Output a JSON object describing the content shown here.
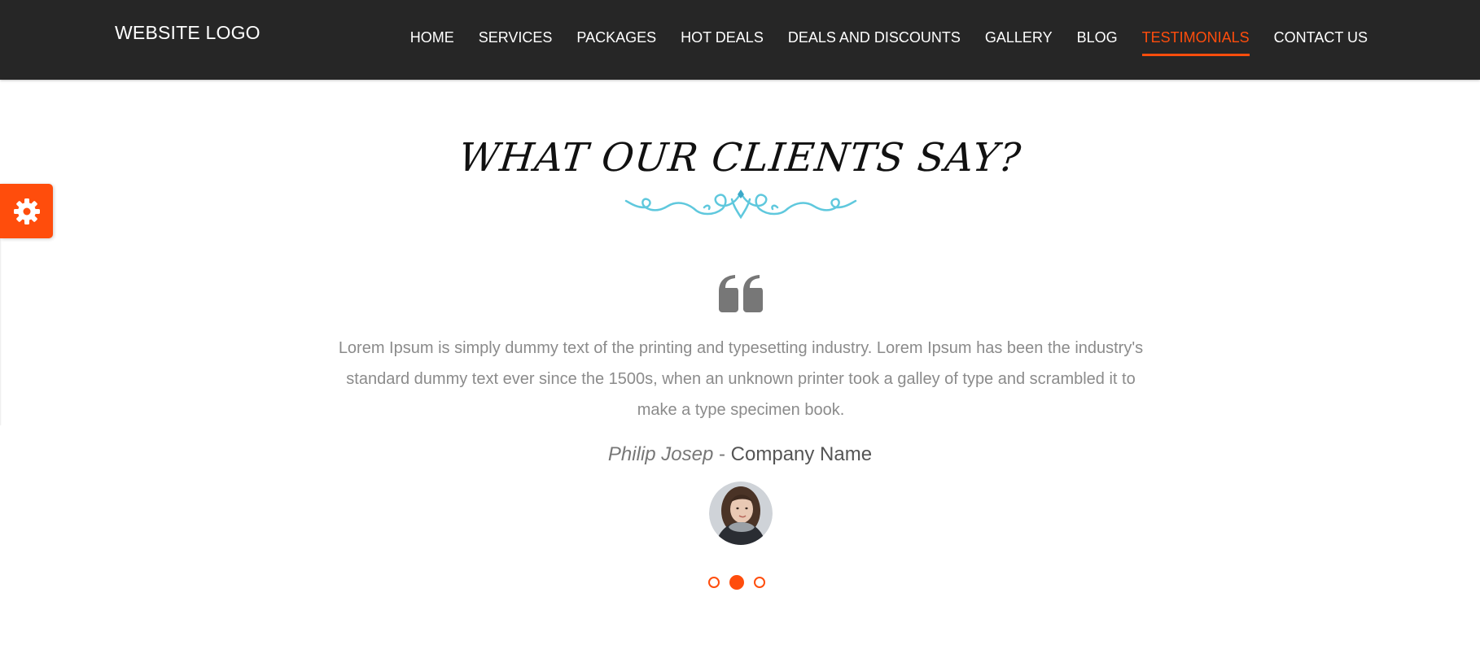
{
  "header": {
    "logo_text": "WEBSITE LOGO",
    "nav": [
      {
        "label": "HOME",
        "active": false
      },
      {
        "label": "SERVICES",
        "active": false
      },
      {
        "label": "PACKAGES",
        "active": false
      },
      {
        "label": "HOT DEALS",
        "active": false
      },
      {
        "label": "DEALS AND DISCOUNTS",
        "active": false
      },
      {
        "label": "GALLERY",
        "active": false
      },
      {
        "label": "BLOG",
        "active": false
      },
      {
        "label": "TESTIMONIALS",
        "active": true
      },
      {
        "label": "CONTACT US",
        "active": false
      }
    ]
  },
  "settings": {
    "icon": "gear-icon"
  },
  "testimonials": {
    "title": "WHAT OUR CLIENTS SAY?",
    "quote": "Lorem Ipsum is simply dummy text of the printing and typesetting industry. Lorem Ipsum has been the industry's standard dummy text ever since the 1500s, when an unknown printer took a galley of type and scrambled it to make a type specimen book.",
    "author_name": "Philip Josep",
    "separator": " - ",
    "company": "Company Name",
    "slide_count": 3,
    "active_slide": 2
  },
  "colors": {
    "accent": "#ff4d0c",
    "navbar_bg": "#262626",
    "ornament": "#5fc8dd",
    "quote_icon": "#777777"
  }
}
